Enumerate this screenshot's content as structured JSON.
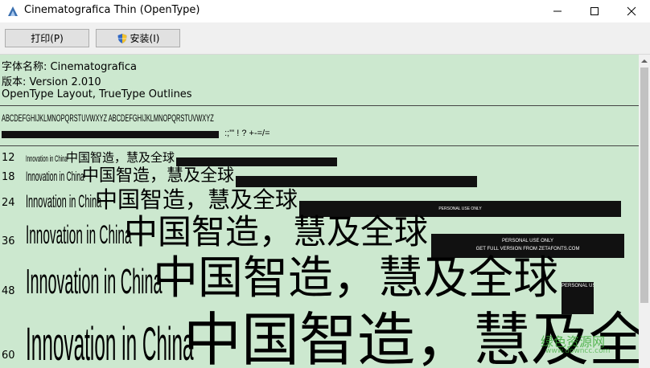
{
  "window": {
    "title": "Cinematografica Thin (OpenType)",
    "controls": {
      "minimize": "—",
      "maximize": "☐",
      "close": "✕"
    }
  },
  "toolbar": {
    "print_label": "打印(P)",
    "install_label": "安装(I)"
  },
  "font_info": {
    "name_line": "字体名称: Cinematografica",
    "version_line": "版本: Version 2.010",
    "type_line": "OpenType Layout, TrueType Outlines"
  },
  "charset": {
    "line1": "ABCDEFGHIJKLMNOPQRSTUVWXYZ ABCDEFGHIJKLMNOPQRSTUVWXYZ",
    "line2_tail": ":;'\" ! ? +-=/="
  },
  "samples": {
    "latin_text": "Innovation in China",
    "cjk_text": "中国智造，慧及全球",
    "watermark_text": "PERSONAL USE ONLY",
    "watermark_sub": "GET FULL VERSION FROM ZETAFONTS.COM",
    "sizes": [
      "12",
      "18",
      "24",
      "36",
      "48",
      "60"
    ]
  },
  "overlay_watermark": {
    "text": "绿色资源网",
    "url": "www.downcc.com"
  },
  "colors": {
    "preview_bg": "#cce8cf",
    "toolbar_bg": "#f0f0f0"
  }
}
